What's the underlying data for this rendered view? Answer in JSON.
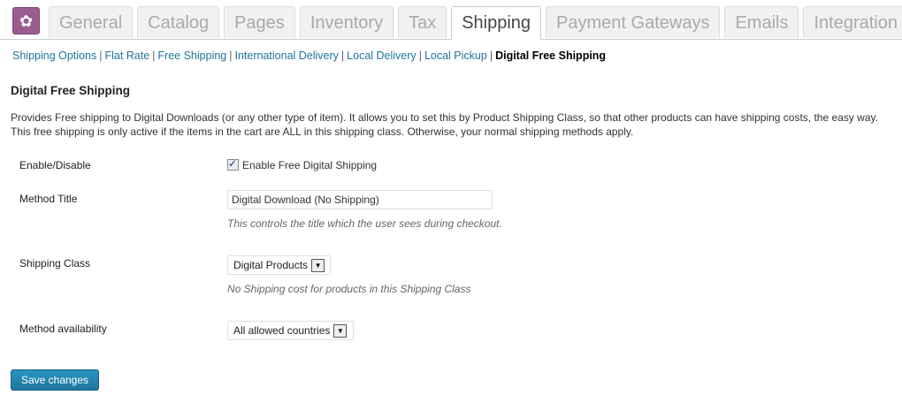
{
  "tabs": [
    {
      "label": "General"
    },
    {
      "label": "Catalog"
    },
    {
      "label": "Pages"
    },
    {
      "label": "Inventory"
    },
    {
      "label": "Tax"
    },
    {
      "label": "Shipping"
    },
    {
      "label": "Payment Gateways"
    },
    {
      "label": "Emails"
    },
    {
      "label": "Integration"
    }
  ],
  "active_tab": "Shipping",
  "logo_icon": "gear-icon",
  "subnav": {
    "items": [
      "Shipping Options",
      "Flat Rate",
      "Free Shipping",
      "International Delivery",
      "Local Delivery",
      "Local Pickup"
    ],
    "current": "Digital Free Shipping",
    "separator": "|"
  },
  "section": {
    "title": "Digital Free Shipping",
    "description": "Provides Free shipping to Digital Downloads (or any other type of item). It allows you to set this by Product Shipping Class, so that other products can have shipping costs, the easy way. This free shipping is only active if the items in the cart are ALL in this shipping class. Otherwise, your normal shipping methods apply."
  },
  "form": {
    "enable": {
      "label": "Enable/Disable",
      "checkbox_label": "Enable Free Digital Shipping",
      "checked": true
    },
    "method_title": {
      "label": "Method Title",
      "value": "Digital Download (No Shipping)",
      "hint": "This controls the title which the user sees during checkout."
    },
    "shipping_class": {
      "label": "Shipping Class",
      "value": "Digital Products",
      "hint": "No Shipping cost for products in this Shipping Class"
    },
    "availability": {
      "label": "Method availability",
      "value": "All allowed countries"
    }
  },
  "save_label": "Save changes",
  "colors": {
    "accent": "#21759b",
    "logo": "#9b5c8f"
  }
}
